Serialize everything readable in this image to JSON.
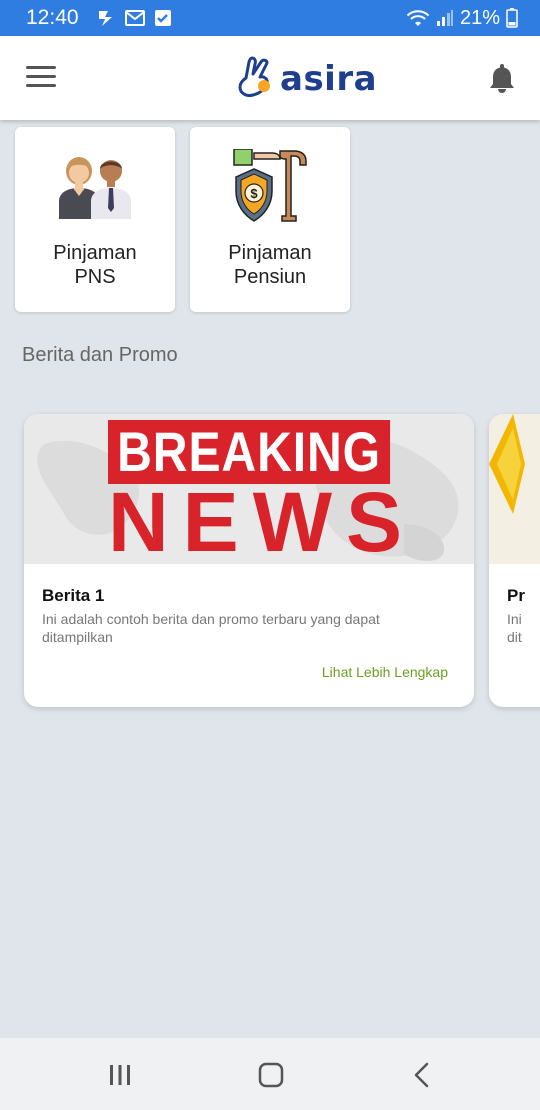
{
  "status_bar": {
    "time": "12:40",
    "battery": "21%",
    "left_icons": [
      "bolt-notification-icon",
      "mail-icon",
      "checkbox-icon"
    ],
    "right_icons": [
      "wifi-icon",
      "signal-icon",
      "battery-icon"
    ]
  },
  "header": {
    "logo_text": "asira",
    "menu_icon": "hamburger-menu-icon",
    "bell_icon": "bell-icon"
  },
  "products": [
    {
      "line1": "Pinjaman",
      "line2": "PNS",
      "icon": "civil-servants-icon"
    },
    {
      "line1": "Pinjaman",
      "line2": "Pensiun",
      "icon": "pension-cane-shield-icon"
    }
  ],
  "section_title": "Berita dan Promo",
  "news": [
    {
      "image_line1": "BREAKING",
      "image_line2": "NEWS",
      "title": "Berita 1",
      "description": "Ini adalah contoh berita dan promo terbaru yang dapat ditampilkan",
      "more_label": "Lihat Lebih Lengkap"
    },
    {
      "title_partial": "Pr",
      "desc_partial_1": "Ini",
      "desc_partial_2": "dit"
    }
  ],
  "colors": {
    "status_bar": "#2f7de0",
    "brand_blue": "#1e3e8f",
    "brand_orange": "#f5a623",
    "breaking_red": "#d8232a",
    "link_green": "#6a9f1f",
    "background": "#dfe5ea"
  },
  "nav": {
    "recents_icon": "recent-apps-icon",
    "home_icon": "home-icon",
    "back_icon": "back-icon"
  }
}
